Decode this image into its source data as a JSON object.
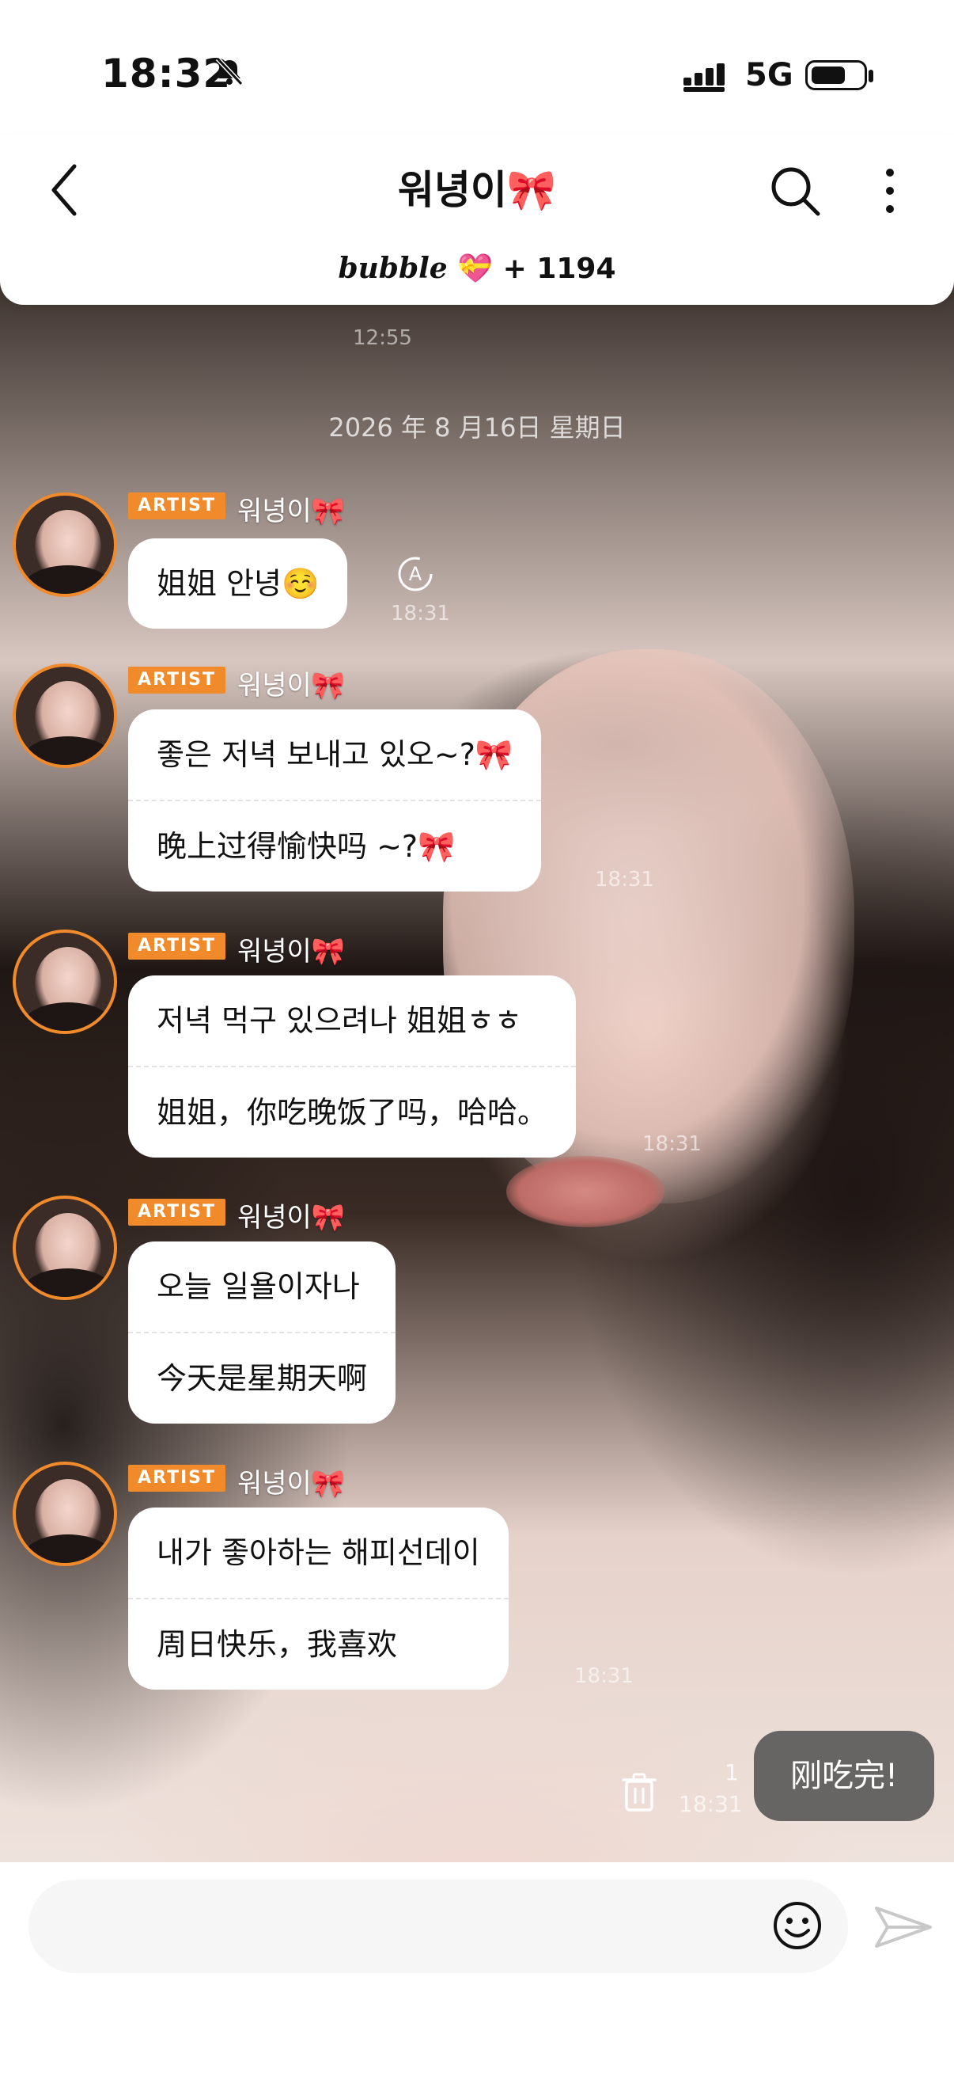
{
  "status_bar": {
    "time": "18:32",
    "network": "5G"
  },
  "header": {
    "title": "워녕이🎀",
    "brand": "bubble",
    "heart": "💝",
    "count": "+ 1194"
  },
  "date_divider": "2026 年 8 月16日  星期日",
  "ghost_time": "12:55",
  "artist_badge": "ARTIST",
  "sender_name": "워녕이🎀",
  "messages": [
    {
      "lines": [
        "姐姐 안녕☺️"
      ],
      "time": "18:31",
      "translate": true
    },
    {
      "lines": [
        "좋은 저녁 보내고 있오~?🎀",
        "晚上过得愉快吗 ~?🎀"
      ],
      "time": "18:31"
    },
    {
      "lines": [
        "저녁 먹구 있으려나 姐姐ㅎㅎ",
        "姐姐，你吃晚饭了吗，哈哈。"
      ],
      "time": "18:31"
    },
    {
      "lines": [
        "오늘 일욜이자나",
        "今天是星期天啊"
      ],
      "time": ""
    },
    {
      "lines": [
        "내가 좋아하는 해피선데이",
        "周日快乐，我喜欢"
      ],
      "time": "18:31"
    }
  ],
  "my_message": {
    "text": "刚吃完!",
    "unread": "1",
    "time": "18:31"
  },
  "input": {
    "placeholder": "",
    "value": ""
  },
  "colors": {
    "accent": "#f08a2b",
    "bubble": "#ffffff",
    "mine_bubble": "#5a5a5a"
  },
  "icons": [
    "mute-icon",
    "signal-icon",
    "battery-icon",
    "back-icon",
    "search-icon",
    "more-icon",
    "translate-icon",
    "trash-icon",
    "emoji-icon",
    "send-icon"
  ]
}
